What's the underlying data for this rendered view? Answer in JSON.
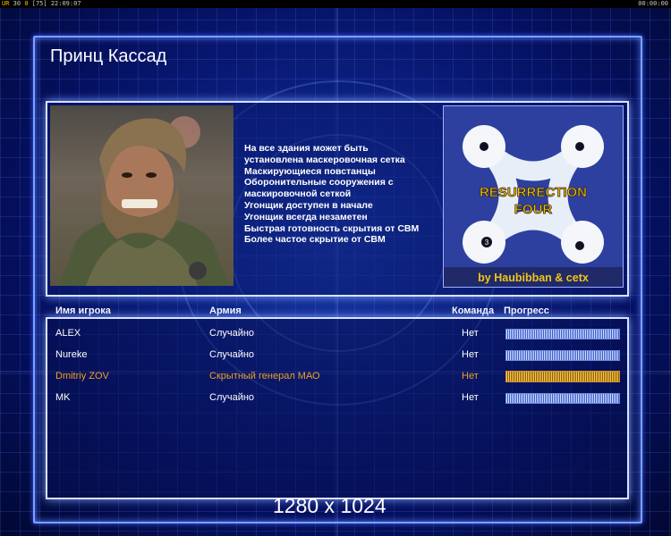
{
  "topbar": {
    "left_a": "UR",
    "left_b": "30",
    "left_c": "0",
    "left_d": "[75]",
    "time": "22:09:07",
    "right": "00:00:00"
  },
  "title": "Принц Кассад",
  "rules": [
    "На все здания может быть",
    " установлена маскеровочная сетка",
    "Маскирующиеся повстанцы",
    "Оборонительные сооружения с",
    " маскировочной сеткой",
    "Угонщик доступен в начале",
    "Угонщик всегда незаметен",
    "Быстрая готовность скрытия от СВМ",
    "Более частое скрытие от СВМ"
  ],
  "map": {
    "name_line1": "RESURRECTION",
    "name_line2": "FOUR",
    "author": "by Haubibban & cetx",
    "slot_label": "3"
  },
  "headers": {
    "player": "Имя игрока",
    "army": "Армия",
    "team": "Команда",
    "progress": "Прогресс"
  },
  "players": [
    {
      "name": "ALEX",
      "army": "Случайно",
      "team": "Нет",
      "progress": 1.0,
      "highlight": false
    },
    {
      "name": "Nureke",
      "army": "Случайно",
      "team": "Нет",
      "progress": 1.0,
      "highlight": false
    },
    {
      "name": "Dmitriy ZOV",
      "army": "Скрытный генерал МАО",
      "team": "Нет",
      "progress": 1.0,
      "highlight": true
    },
    {
      "name": "MK",
      "army": "Случайно",
      "team": "Нет",
      "progress": 1.0,
      "highlight": false
    }
  ],
  "resolution": "1280 x 1024",
  "colors": {
    "accent": "#7aa0ff",
    "highlight": "#f0a020"
  }
}
